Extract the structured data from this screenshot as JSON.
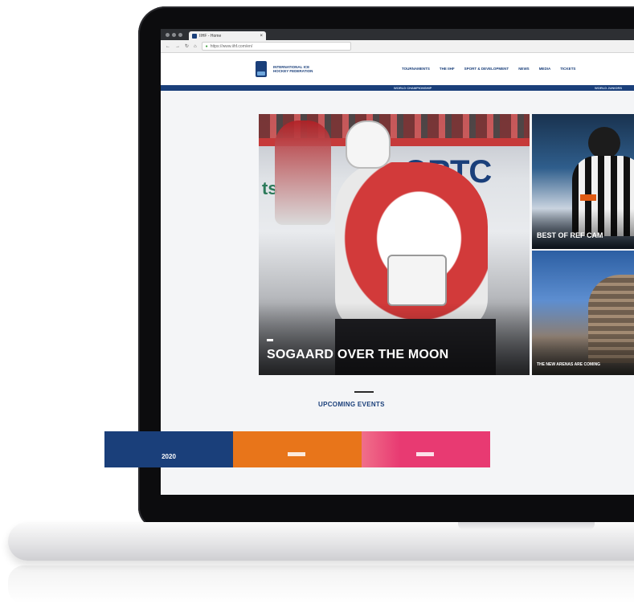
{
  "browser": {
    "tab_title": "IIHF - Home",
    "url": "https://www.iihf.com/en/"
  },
  "site": {
    "logo_text": "INTERNATIONAL ICE HOCKEY FEDERATION",
    "nav": [
      "TOURNAMENTS",
      "THE IIHF",
      "SPORT & DEVELOPMENT",
      "NEWS",
      "MEDIA",
      "TICKETS"
    ],
    "subbar_left": "WORLD CHAMPIONSHIP",
    "subbar_right": "WORLD JUNIORS"
  },
  "hero": {
    "main_title": "SOGAARD OVER THE MOON",
    "tile_top_title": "BEST OF REF CAM",
    "tile_bottom_title": "THE NEW ARENAS ARE COMING"
  },
  "events": {
    "heading": "UPCOMING EVENTS",
    "cards": [
      {
        "label": "2020"
      },
      {
        "label": ""
      },
      {
        "label": ""
      }
    ]
  },
  "colors": {
    "brand_navy": "#1a3f7a",
    "orange": "#e8751a",
    "pink": "#e83a72"
  }
}
